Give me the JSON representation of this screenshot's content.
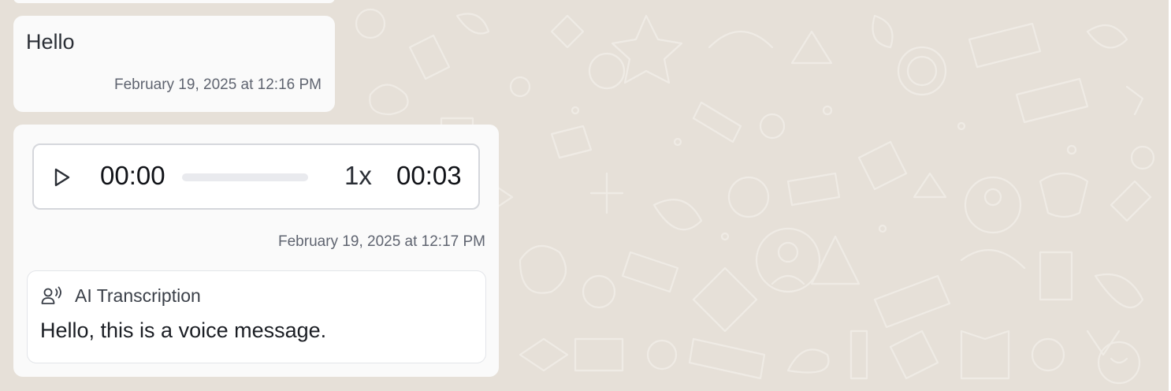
{
  "messages": [
    {
      "type": "text",
      "text": "Hello",
      "timestamp": "February 19, 2025 at 12:16 PM"
    },
    {
      "type": "voice",
      "audio": {
        "current_time": "00:00",
        "duration": "00:03",
        "speed": "1x",
        "progress": 0
      },
      "timestamp": "February 19, 2025 at 12:17 PM",
      "transcription": {
        "icon": "voice-person-icon",
        "title": "AI Transcription",
        "text": "Hello, this is a voice message."
      }
    }
  ],
  "icons": {
    "play": "play-icon"
  },
  "colors": {
    "wallpaper": "#e6e0d8",
    "bubble": "#fafafa",
    "doodle_stroke": "#f1ede7"
  }
}
